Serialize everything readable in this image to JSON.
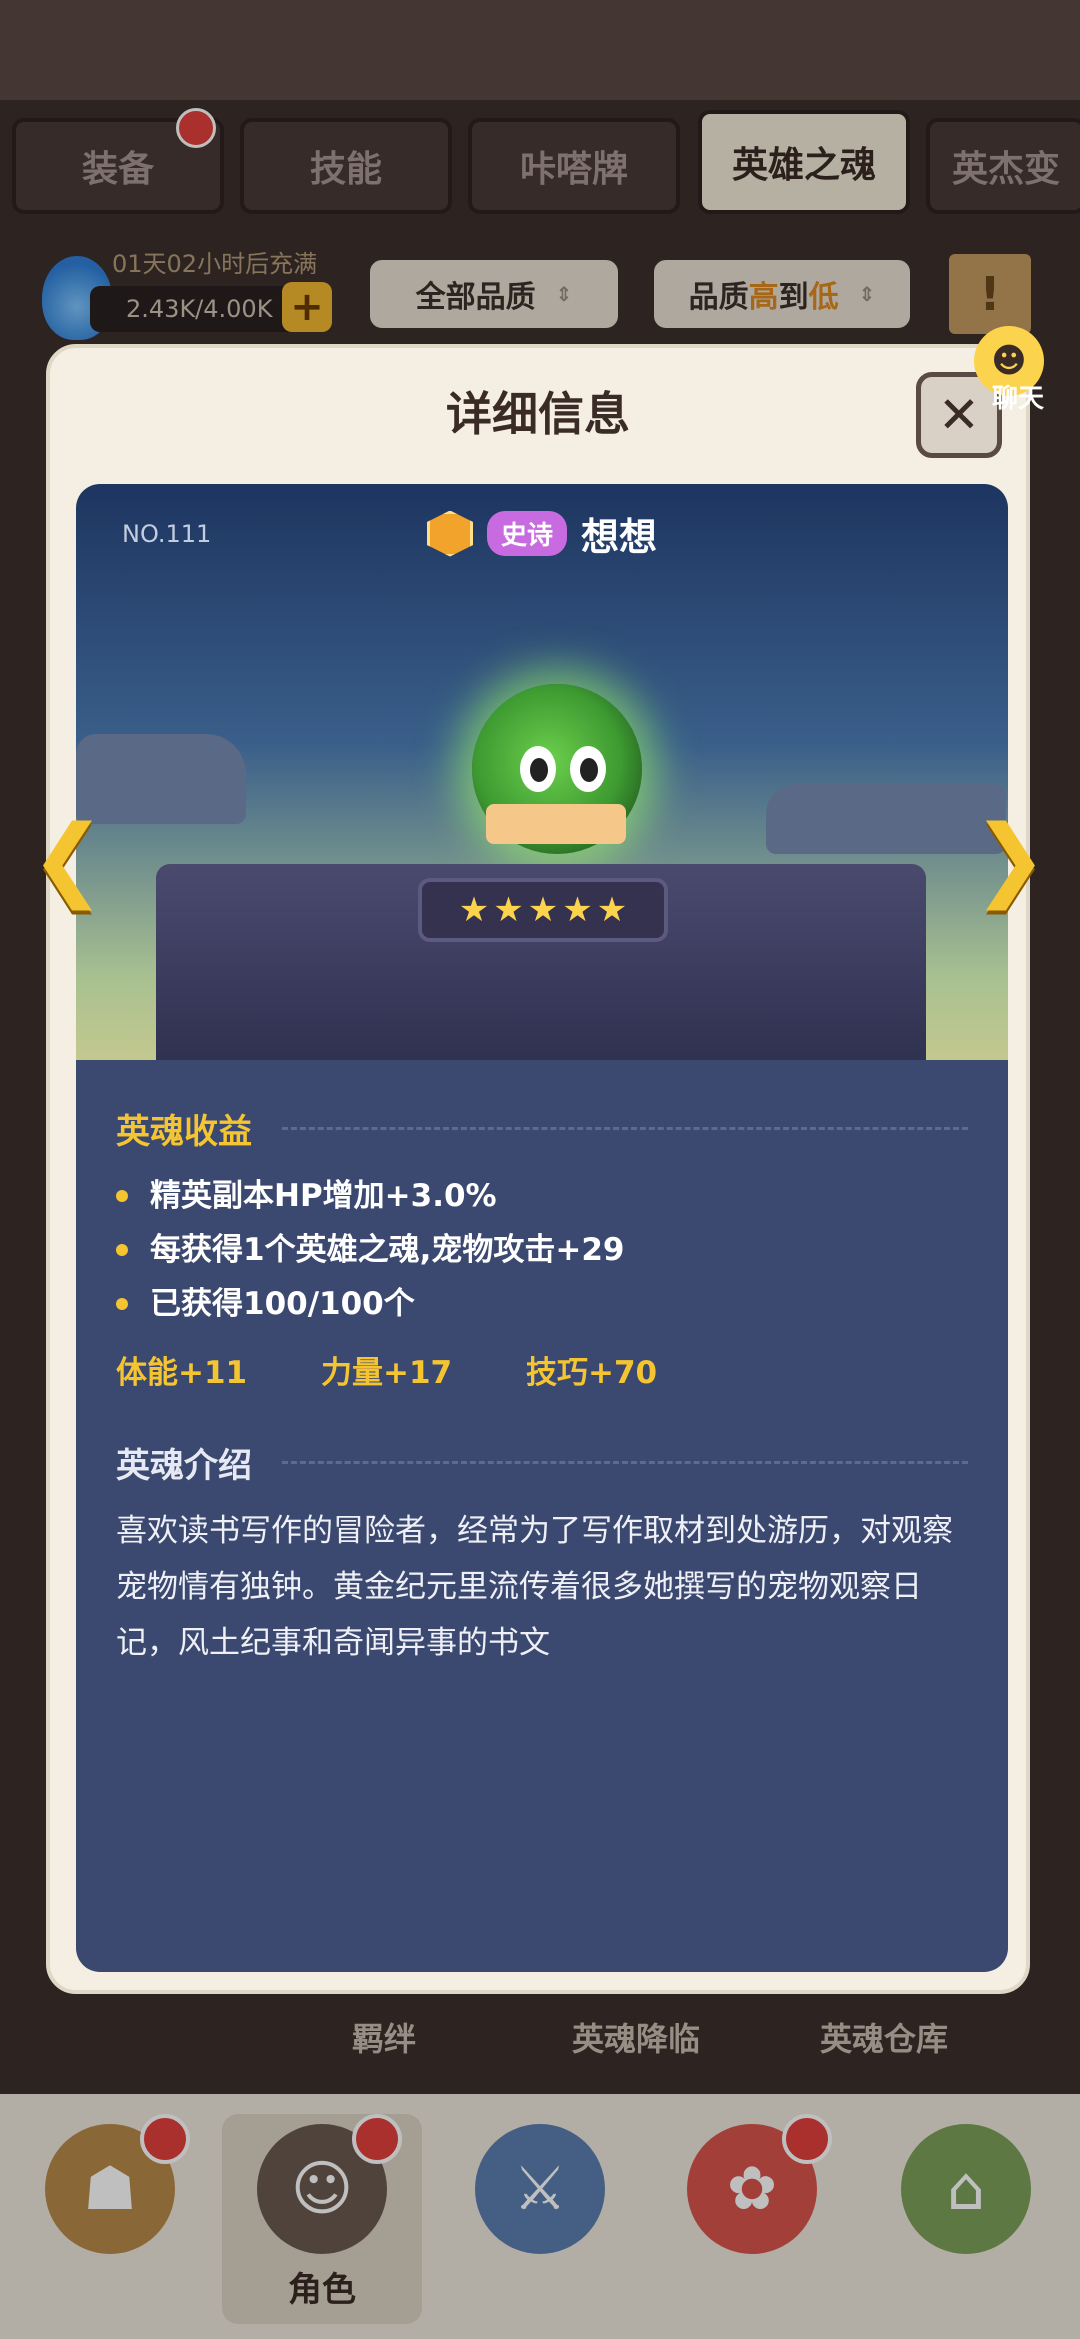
{
  "tabs": [
    {
      "label": "装备",
      "active": false,
      "badge": true
    },
    {
      "label": "技能",
      "active": false,
      "badge": false
    },
    {
      "label": "咔嗒牌",
      "active": false,
      "badge": false
    },
    {
      "label": "英雄之魂",
      "active": true,
      "badge": false
    },
    {
      "label": "英杰变",
      "active": false,
      "badge": false
    }
  ],
  "resource": {
    "timer": "01天02小时后充满",
    "amount": "2.43K/4.00K",
    "plus_label": "+",
    "icon": "blue-flame-icon"
  },
  "filters": {
    "quality": "全部品质",
    "sort_prefix": "品质",
    "sort_high": "高",
    "sort_mid": "到",
    "sort_low": "低",
    "filter_icon_label": "!"
  },
  "modal": {
    "title": "详细信息",
    "close_label": "✕",
    "chat_label": "聊天",
    "hero": {
      "number": "NO.111",
      "rarity": "史诗",
      "name": "想想",
      "stars": 5
    },
    "benefits": {
      "title": "英魂收益",
      "items": [
        "精英副本HP增加+3.0%",
        "每获得1个英雄之魂,宠物攻击+29",
        "已获得100/100个"
      ]
    },
    "stats": [
      "体能+11",
      "力量+17",
      "技巧+70"
    ],
    "intro": {
      "title": "英魂介绍",
      "text": "喜欢读书写作的冒险者，经常为了写作取材到处游历，对观察宠物情有独钟。黄金纪元里流传着很多她撰写的宠物观察日记，风土纪事和奇闻异事的书文"
    }
  },
  "bottom_links": [
    "羁绊",
    "英魂降临",
    "英魂仓库"
  ],
  "nav": [
    {
      "label": "",
      "icon": "hero-camp-icon",
      "badge": true,
      "active": false,
      "color": "#b88a4a"
    },
    {
      "label": "角色",
      "icon": "character-icon",
      "badge": true,
      "active": true,
      "color": "#6b5a50"
    },
    {
      "label": "",
      "icon": "sword-icon",
      "badge": false,
      "active": false,
      "color": "#5c7fb0"
    },
    {
      "label": "",
      "icon": "pet-icon",
      "badge": true,
      "active": false,
      "color": "#d9544d"
    },
    {
      "label": "",
      "icon": "guild-icon",
      "badge": false,
      "active": false,
      "color": "#7da05a"
    }
  ]
}
